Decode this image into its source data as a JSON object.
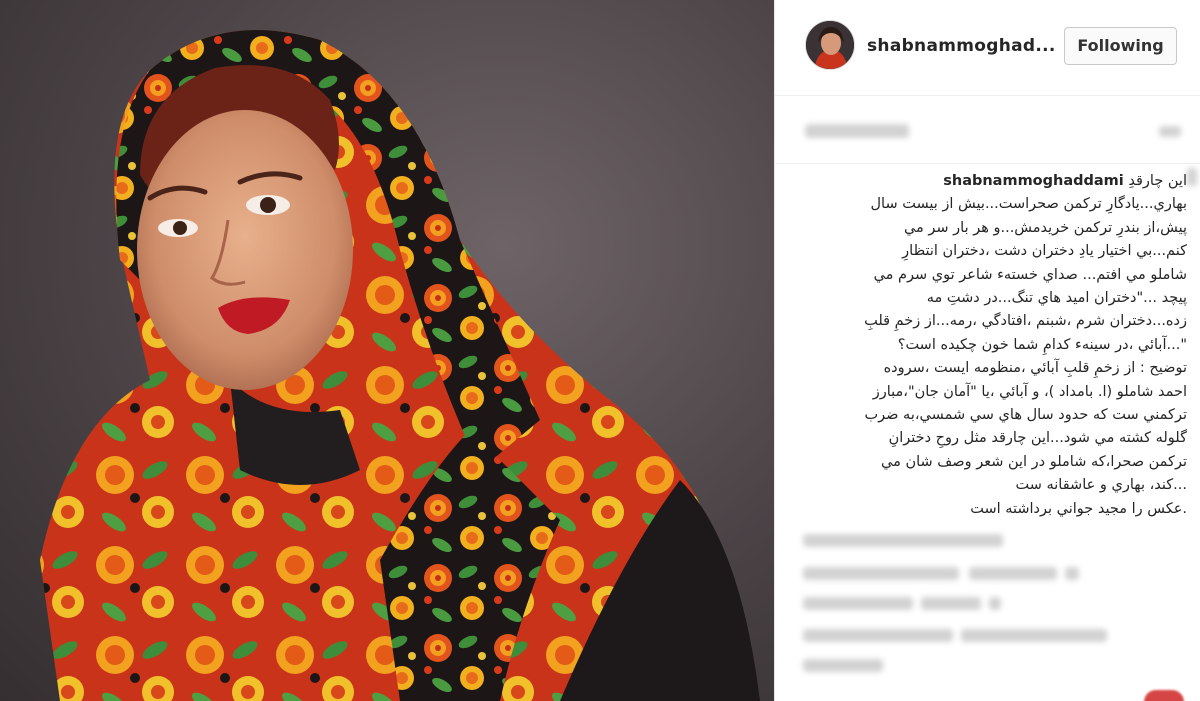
{
  "post": {
    "username": "shabnammoghad...",
    "follow_button_label": "Following",
    "caption_username": "shabnammoghaddami",
    "caption_first_line": "اين چارقدِ",
    "caption_lines": [
      "بهاري...يادگارِ تركمن صحراست...بيش از بيست سال",
      "پيش،از بندرِ تركمن خريدمش...و هر بار سر مي",
      "كنم...بي اختيار يادِ دختران دشت ،دختران انتظارِ",
      "شاملو مي افتم... صداي خستهء شاعر توي سرم مي",
      "پيچد ...\"دختران اميد هاي تنگ...در دشتِ مه",
      "زده...دختران شرم ،شبنم ،افتادگي ،رمه...از زخمِ قلبِ",
      "\"...آبائي ،در سينهء كدامِ شما خون چكيده است؟",
      "توضيح : از زخمِ قلبِ آبائي ،منظومه ايست ،سروده",
      "احمد شاملو (ا. بامداد )، و آبائي ،يا \"آمان جان\"،مبارز",
      "تركمني ست كه حدود سال هاي سي شمسي،به ضرب",
      "گلوله كشته مي شود...اين چارقد مثل روحِ دخترانِ",
      "تركمن صحرا،كه شاملو در اين شعر وصف شان مي",
      "...كند، بهاري و عاشقانه ست",
      ".عكس را مجيد جواني برداشته است"
    ]
  },
  "icons": {
    "avatar": "profile-photo-avatar",
    "comment_badge": "red-badge-icon"
  },
  "colors": {
    "background": "#ffffff",
    "text": "#262626",
    "button_border": "#c9c9c9",
    "photo_backdrop": "#4b4346"
  }
}
